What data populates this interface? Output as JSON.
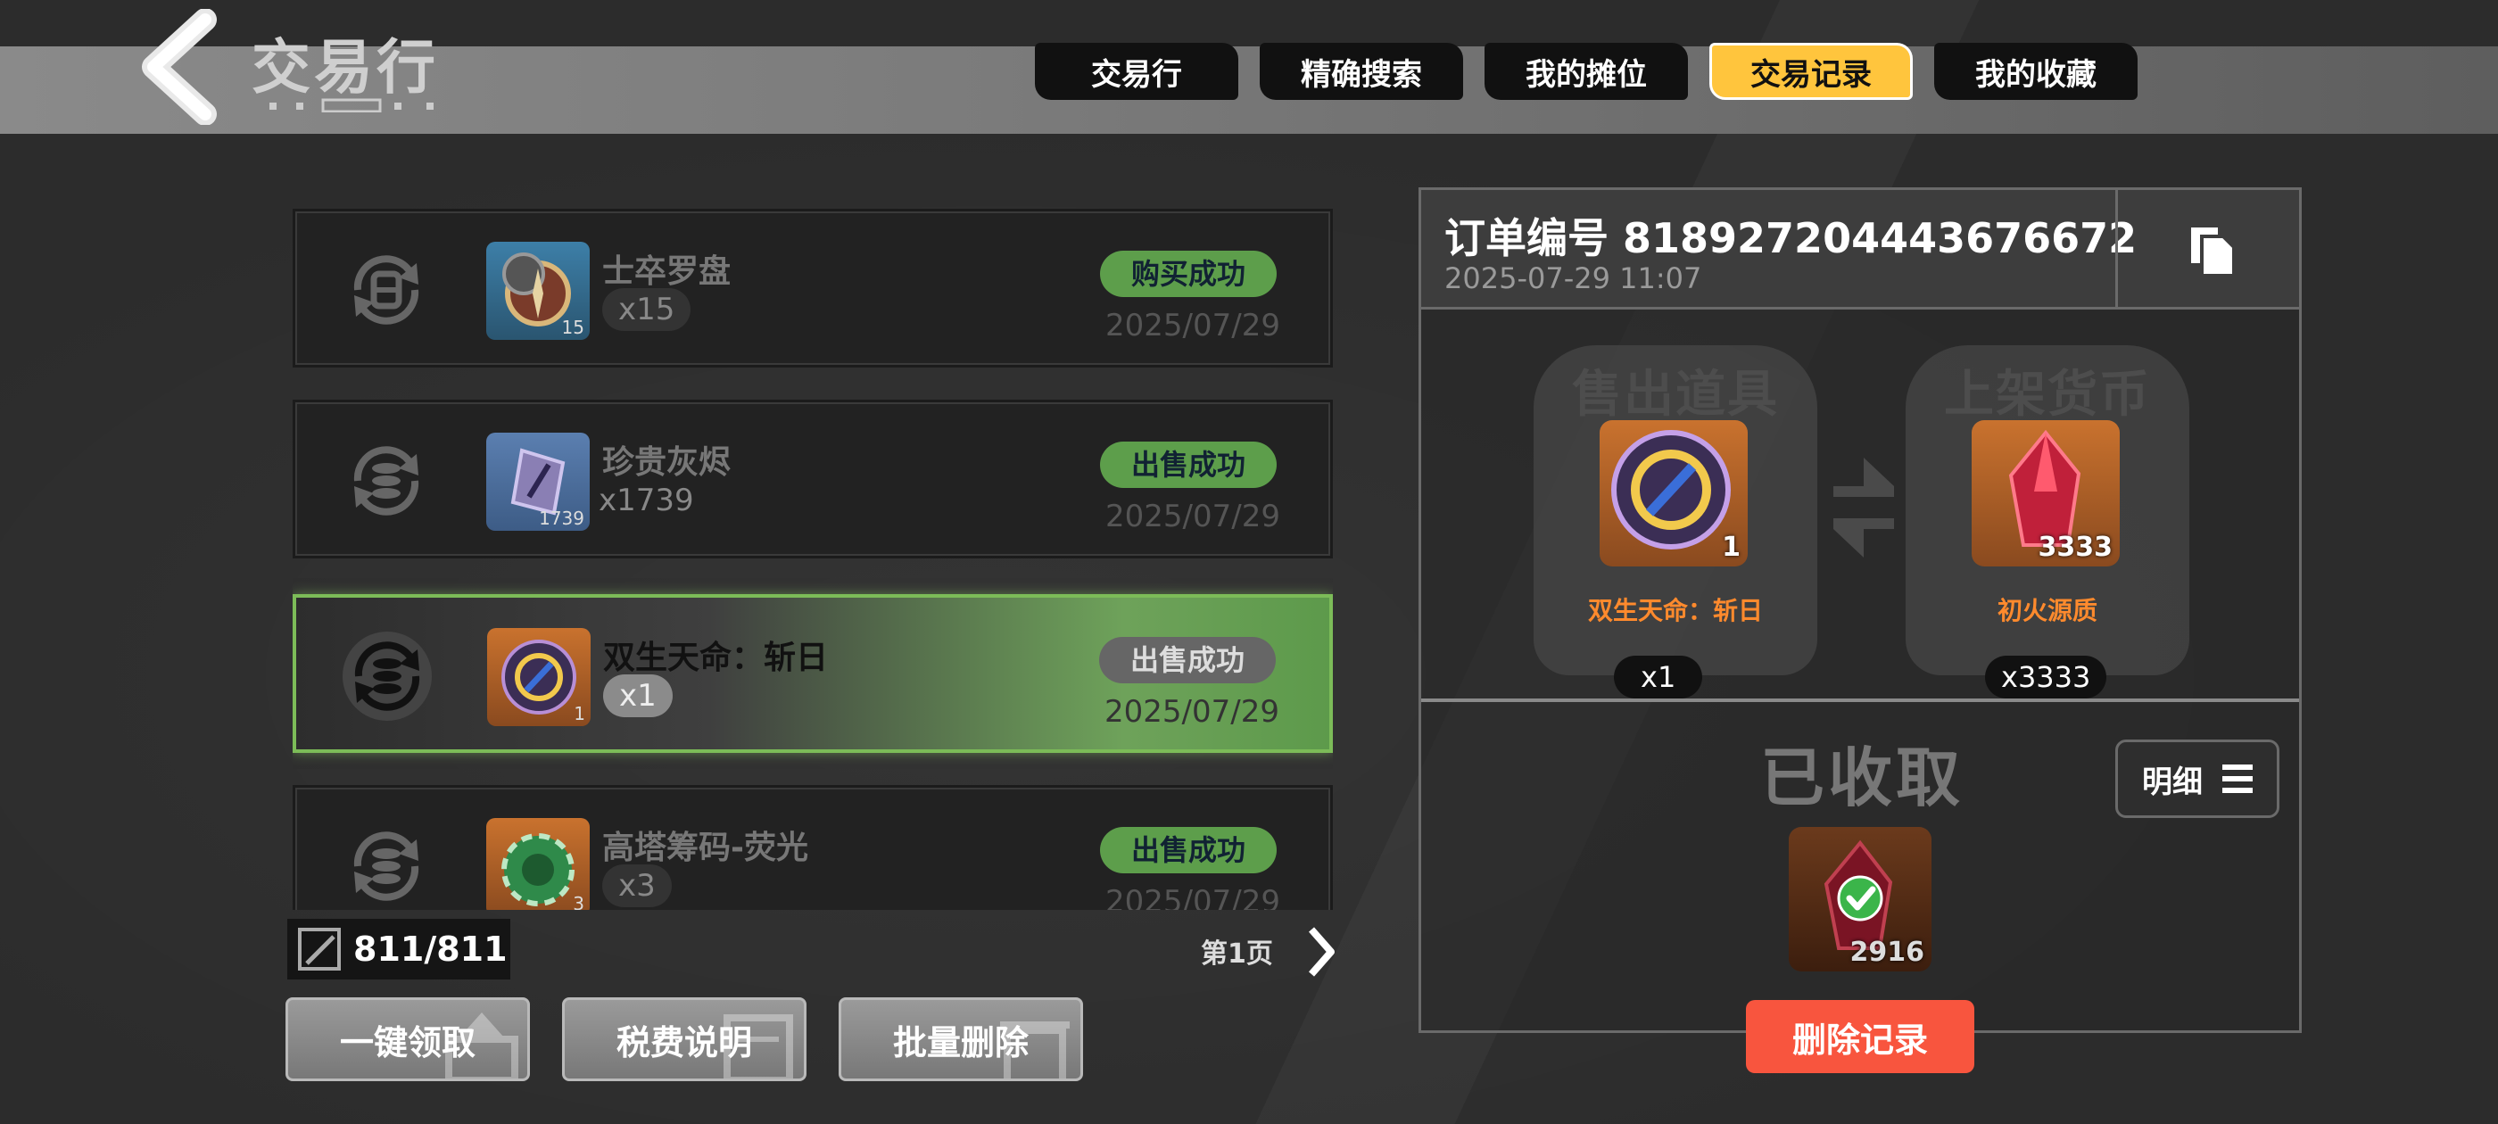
{
  "header": {
    "title": "交易行",
    "tabs": [
      {
        "label": "交易行",
        "active": false
      },
      {
        "label": "精确搜索",
        "active": false
      },
      {
        "label": "我的摊位",
        "active": false
      },
      {
        "label": "交易记录",
        "active": true
      },
      {
        "label": "我的收藏",
        "active": false
      }
    ]
  },
  "records": [
    {
      "name": "士卒罗盘",
      "qty": "x15",
      "thumb_count": "15",
      "status": "购买成功",
      "date": "2025/07/29",
      "icon": "compass-icon",
      "selected": false
    },
    {
      "name": "珍贵灰烬",
      "qty": "x1739",
      "thumb_count": "1739",
      "status": "出售成功",
      "date": "2025/07/29",
      "icon": "ash-crystal-icon",
      "selected": false
    },
    {
      "name": "双生天命：斩日",
      "qty": "x1",
      "thumb_count": "1",
      "status": "出售成功",
      "date": "2025/07/29",
      "icon": "sun-emblem-icon",
      "selected": true
    },
    {
      "name": "高塔筹码-荧光",
      "qty": "x3",
      "thumb_count": "3",
      "status": "出售成功",
      "date": "2025/07/29",
      "icon": "chip-icon",
      "selected": false
    }
  ],
  "footer": {
    "count": "811/811",
    "page": "第1页",
    "buttons": {
      "claim_all": "一键领取",
      "tax_info": "税费说明",
      "batch_delete": "批量删除"
    }
  },
  "detail": {
    "order_number": "订单编号 818927204443676672",
    "time": "2025-07-29 11:07",
    "sold": {
      "title": "售出道具",
      "item_name": "双生天命：斩日",
      "item_count": "1",
      "qty": "x1"
    },
    "listed": {
      "title": "上架货币",
      "item_name": "初火源质",
      "item_count": "3333",
      "qty": "x3333"
    },
    "collected_label": "已收取",
    "detail_button": "明细",
    "collected_count": "2916",
    "delete_button": "删除记录"
  },
  "colors": {
    "tab_active": "#ffc53d",
    "status_green": "#5d9e4b",
    "delete_red": "#f8553e",
    "item_name_orange": "#ff8a2d"
  }
}
